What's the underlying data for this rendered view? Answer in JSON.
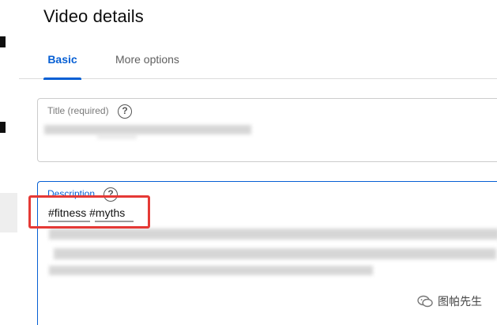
{
  "page": {
    "title": "Video details"
  },
  "tabs": [
    {
      "label": "Basic",
      "active": true
    },
    {
      "label": "More options",
      "active": false
    }
  ],
  "title_field": {
    "label": "Title (required)"
  },
  "description_field": {
    "label": "Description",
    "hashtags": "#fitness #myths"
  },
  "watermark": {
    "text": "图帕先生",
    "icon": "wechat-icon"
  },
  "colors": {
    "accent": "#065fd4",
    "highlight": "#e53935"
  }
}
